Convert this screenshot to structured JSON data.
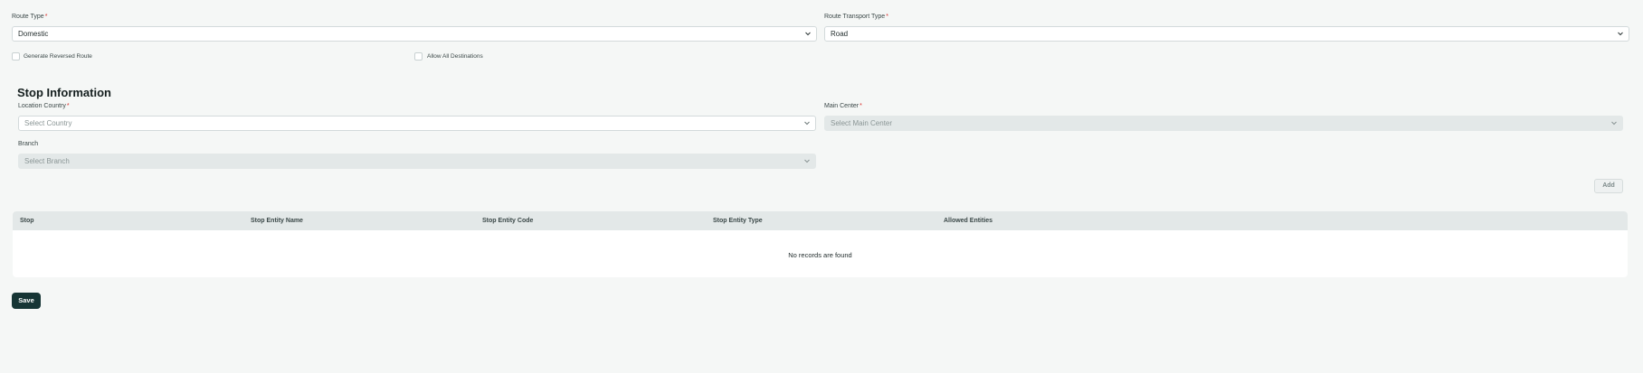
{
  "route": {
    "route_type_label": "Route Type",
    "route_type_value": "Domestic",
    "transport_type_label": "Route Transport Type",
    "transport_type_value": "Road",
    "generate_reversed_label": "Generate Reversed Route",
    "allow_all_destinations_label": "Allow All Destinations"
  },
  "stop_info": {
    "title": "Stop Information",
    "location_country_label": "Location Country",
    "location_country_placeholder": "Select Country",
    "main_center_label": "Main Center",
    "main_center_placeholder": "Select Main Center",
    "branch_label": "Branch",
    "branch_placeholder": "Select Branch",
    "add_label": "Add"
  },
  "table": {
    "columns": [
      "Stop",
      "Stop Entity Name",
      "Stop Entity Code",
      "Stop Entity Type",
      "Allowed Entities"
    ],
    "empty_text": "No records are found"
  },
  "actions": {
    "save_label": "Save"
  },
  "colors": {
    "required": "#d9302c",
    "save_button": "#163535",
    "page_bg": "#f5f7f6"
  }
}
